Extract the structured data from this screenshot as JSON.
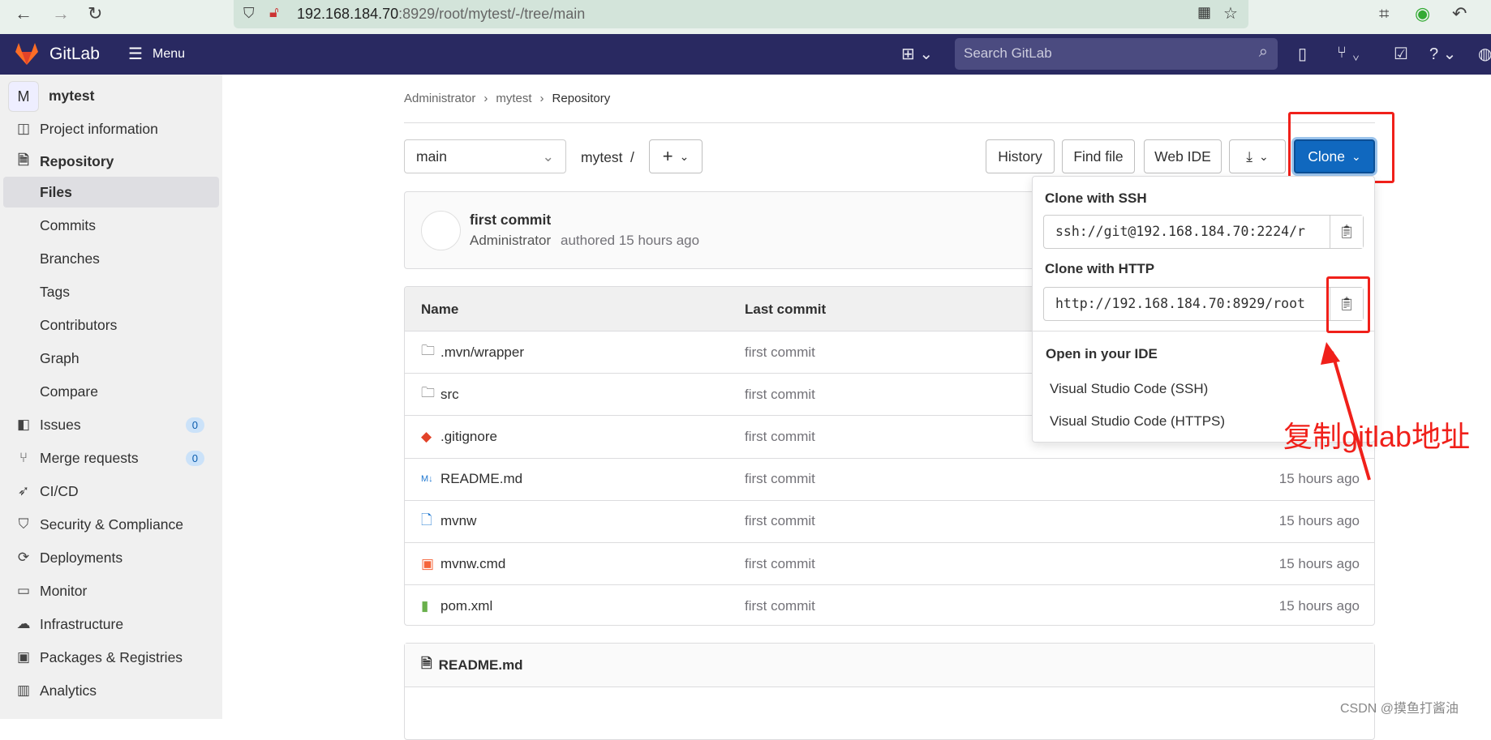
{
  "browser": {
    "url_host": "192.168.184.70",
    "url_rest": ":8929/root/mytest/-/tree/main"
  },
  "header": {
    "brand": "GitLab",
    "menu": "Menu",
    "search_placeholder": "Search GitLab"
  },
  "sidebar": {
    "project_initial": "M",
    "project_name": "mytest",
    "items": [
      {
        "label": "Project information",
        "icon": "project-icon"
      },
      {
        "label": "Repository",
        "icon": "document-icon",
        "bold": true
      },
      {
        "label": "Files",
        "sub": true,
        "active": true
      },
      {
        "label": "Commits",
        "sub": true
      },
      {
        "label": "Branches",
        "sub": true
      },
      {
        "label": "Tags",
        "sub": true
      },
      {
        "label": "Contributors",
        "sub": true
      },
      {
        "label": "Graph",
        "sub": true
      },
      {
        "label": "Compare",
        "sub": true
      },
      {
        "label": "Issues",
        "icon": "issues-icon",
        "badge": "0"
      },
      {
        "label": "Merge requests",
        "icon": "merge-request-icon",
        "badge": "0"
      },
      {
        "label": "CI/CD",
        "icon": "rocket-icon"
      },
      {
        "label": "Security & Compliance",
        "icon": "shield-icon"
      },
      {
        "label": "Deployments",
        "icon": "deployments-icon"
      },
      {
        "label": "Monitor",
        "icon": "monitor-icon"
      },
      {
        "label": "Infrastructure",
        "icon": "cloud-icon"
      },
      {
        "label": "Packages & Registries",
        "icon": "package-icon"
      },
      {
        "label": "Analytics",
        "icon": "chart-icon"
      }
    ]
  },
  "breadcrumb": [
    "Administrator",
    "mytest",
    "Repository"
  ],
  "toolbar": {
    "branch": "main",
    "path": "mytest",
    "path_sep": "/",
    "history": "History",
    "find_file": "Find file",
    "web_ide": "Web IDE",
    "clone": "Clone"
  },
  "commit": {
    "title": "first commit",
    "author": "Administrator",
    "meta": "authored 15 hours ago"
  },
  "table": {
    "headers": [
      "Name",
      "Last commit"
    ],
    "rows": [
      {
        "name": ".mvn/wrapper",
        "icon": "folder-icon",
        "commit": "first commit",
        "time": ""
      },
      {
        "name": "src",
        "icon": "folder-icon",
        "commit": "first commit",
        "time": ""
      },
      {
        "name": ".gitignore",
        "icon": "git-icon",
        "commit": "first commit",
        "time": ""
      },
      {
        "name": "README.md",
        "icon": "markdown-icon",
        "commit": "first commit",
        "time": "15 hours ago"
      },
      {
        "name": "mvnw",
        "icon": "file-icon",
        "commit": "first commit",
        "time": "15 hours ago"
      },
      {
        "name": "mvnw.cmd",
        "icon": "terminal-icon",
        "commit": "first commit",
        "time": "15 hours ago"
      },
      {
        "name": "pom.xml",
        "icon": "xml-icon",
        "commit": "first commit",
        "time": "15 hours ago"
      }
    ]
  },
  "readme": {
    "title": "README.md"
  },
  "clone_dropdown": {
    "ssh_label": "Clone with SSH",
    "ssh_url": "ssh://git@192.168.184.70:2224/r",
    "http_label": "Clone with HTTP",
    "http_url": "http://192.168.184.70:8929/root",
    "ide_label": "Open in your IDE",
    "ide_options": [
      "Visual Studio Code (SSH)",
      "Visual Studio Code (HTTPS)"
    ]
  },
  "annotation": {
    "text": "复制gitlab地址",
    "color": "#f0201a"
  },
  "watermark": "CSDN @摸鱼打酱油",
  "colors": {
    "header": "#292961",
    "primary": "#1068bf",
    "annotation": "#f0201a"
  }
}
